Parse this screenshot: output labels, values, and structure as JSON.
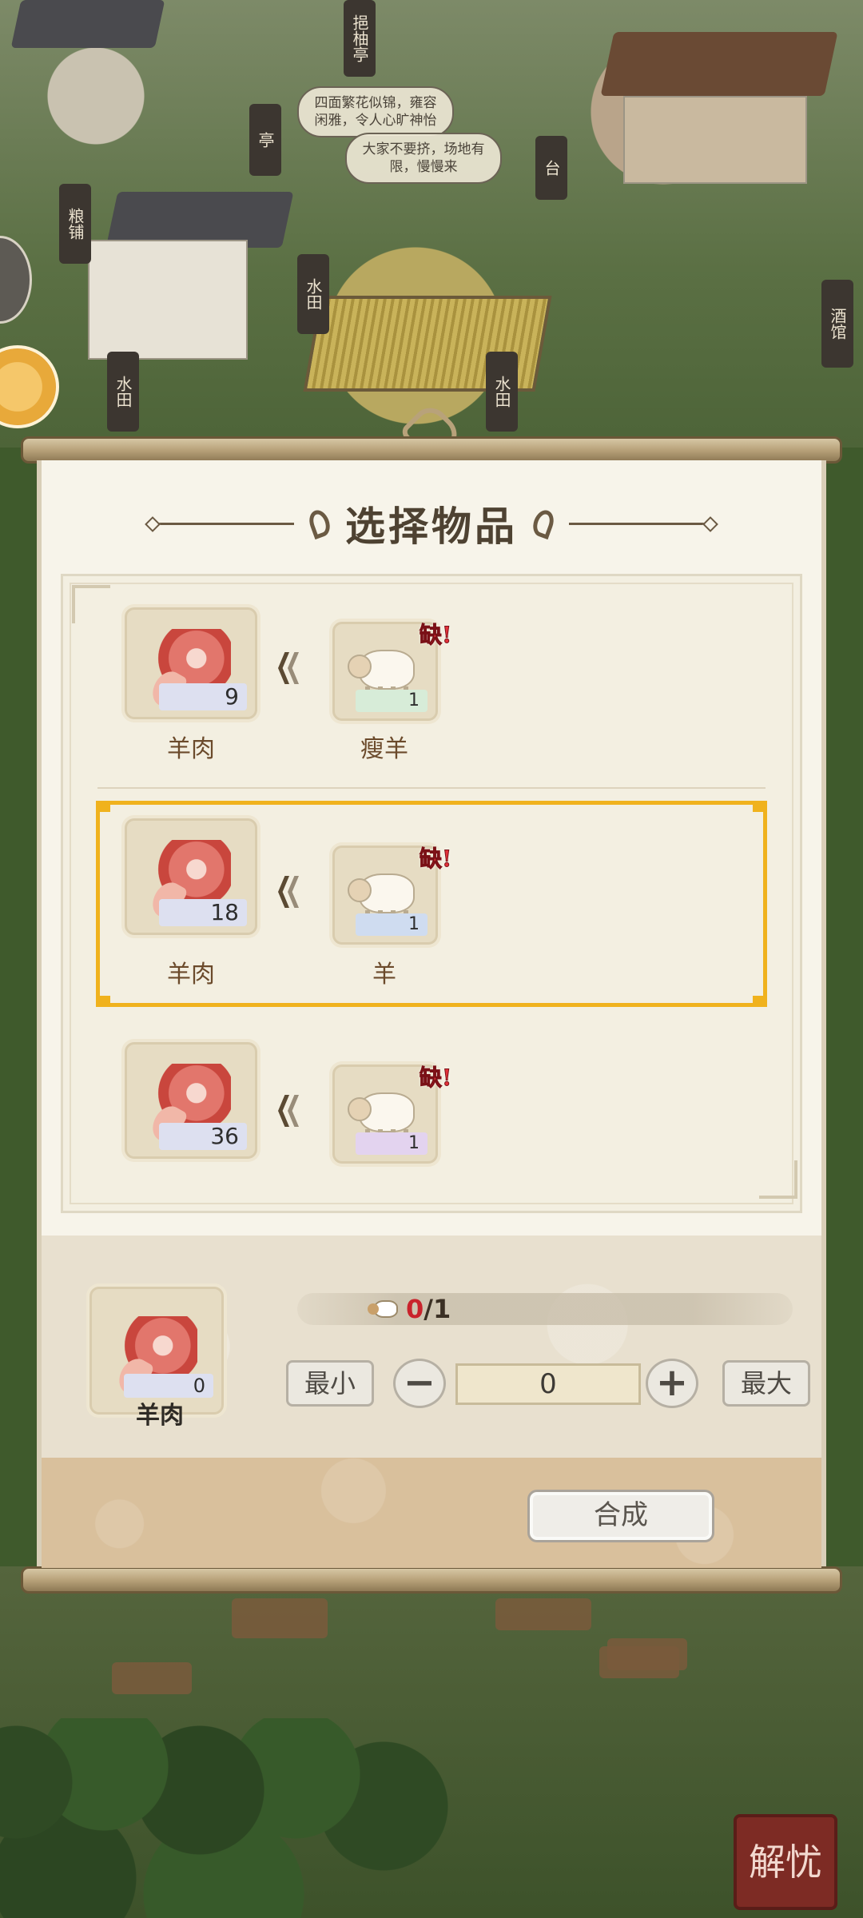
{
  "background": {
    "signs": [
      "粮铺",
      "亭",
      "台",
      "水田",
      "水田",
      "水田",
      "酒馆",
      "挹柚亭"
    ],
    "speech_1": "四面繁花似锦，雍容闲雅，令人心旷神怡",
    "speech_2": "大家不要挤，场地有限，慢慢来",
    "seal_text": [
      "解",
      "忧"
    ]
  },
  "dialog": {
    "title": "选择物品",
    "recipes": [
      {
        "product": "羊肉",
        "product_count": "9",
        "ingredient": "瘦羊",
        "ingredient_count": "1",
        "lack_label": "缺!",
        "selected": false
      },
      {
        "product": "羊肉",
        "product_count": "18",
        "ingredient": "羊",
        "ingredient_count": "1",
        "lack_label": "缺!",
        "selected": true
      },
      {
        "product": "",
        "product_count": "36",
        "ingredient": "",
        "ingredient_count": "1",
        "lack_label": "缺!",
        "selected": false
      }
    ],
    "selection": {
      "item_name": "羊肉",
      "item_count": "0",
      "progress_current": "0",
      "progress_sep": "/1",
      "min_label": "最小",
      "max_label": "最大",
      "minus_label": "−",
      "plus_label": "+",
      "quantity": "0"
    },
    "synthesize_label": "合成"
  },
  "colors": {
    "selected_border": "#f0b21d",
    "lack_red": "#e3323b",
    "label_brown": "#6b4a2b"
  }
}
